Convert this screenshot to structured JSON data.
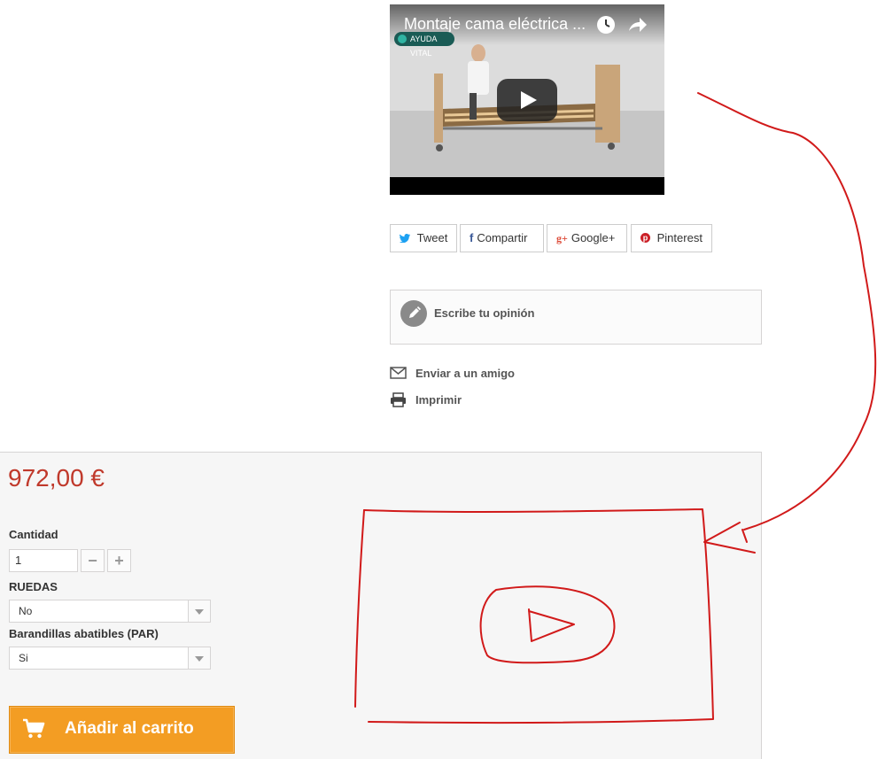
{
  "video": {
    "title": "Montaje cama eléctrica ...",
    "channel": "AYUDA VITAL"
  },
  "social": {
    "tweet": "Tweet",
    "share": "Compartir",
    "google": "Google+",
    "pinterest": "Pinterest"
  },
  "review": {
    "label": "Escribe tu opinión"
  },
  "links": {
    "send_friend": "Enviar a un amigo",
    "print": "Imprimir"
  },
  "product": {
    "price": "972,00 €",
    "quantity_label": "Cantidad",
    "quantity_value": "1",
    "wheels_label": "RUEDAS",
    "wheels_value": "No",
    "rails_label": "Barandillas abatibles (PAR)",
    "rails_value": "Si",
    "add_to_cart": "Añadir al carrito"
  },
  "colors": {
    "price": "#c0392b",
    "cart_button": "#f39d23",
    "annotation": "#d11a1a"
  }
}
